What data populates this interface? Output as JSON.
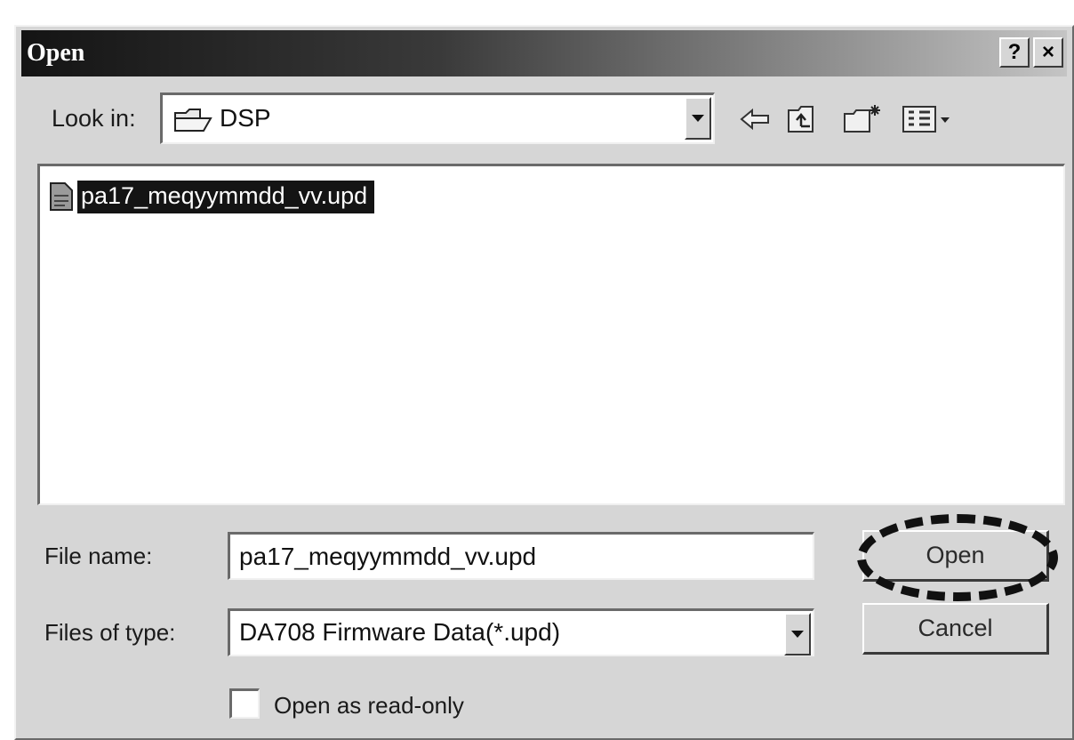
{
  "window": {
    "title": "Open",
    "help_label": "?",
    "close_label": "×"
  },
  "toolbar": {
    "look_in_label": "Look in:",
    "look_in_value": "DSP",
    "icons": [
      "back-arrow-icon",
      "up-one-level-icon",
      "new-folder-icon",
      "views-menu-icon"
    ]
  },
  "file_list": {
    "items": [
      {
        "name": "pa17_meqyymmdd_vv.upd",
        "selected": true
      }
    ]
  },
  "form": {
    "file_name_label": "File name:",
    "file_name_value": "pa17_meqyymmdd_vv.upd",
    "file_type_label": "Files of type:",
    "file_type_value": "DA708 Firmware Data(*.upd)",
    "read_only_label": "Open as read-only",
    "read_only_checked": false
  },
  "buttons": {
    "open_label": "Open",
    "cancel_label": "Cancel"
  }
}
